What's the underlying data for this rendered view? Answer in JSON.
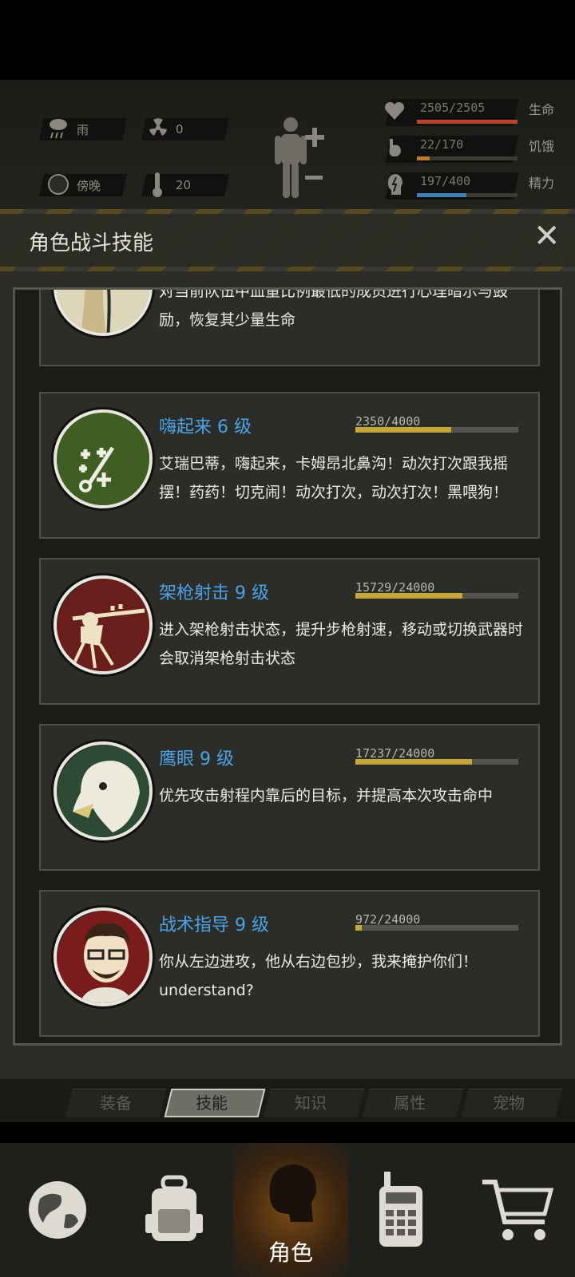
{
  "status": {
    "weather": "雨",
    "radiation": "0",
    "time_of_day": "傍晚",
    "temperature": "20"
  },
  "vitals": [
    {
      "label": "生命",
      "value": "2505/2505",
      "fraction": 1.0,
      "color": "#b8432f"
    },
    {
      "label": "饥饿",
      "value": "22/170",
      "fraction": 0.13,
      "color": "#b87d2f"
    },
    {
      "label": "精力",
      "value": "197/400",
      "fraction": 0.49,
      "color": "#3f7fb8"
    }
  ],
  "panel": {
    "title": "角色战斗技能",
    "close": "✕"
  },
  "skills": [
    {
      "name": "",
      "xp": "",
      "desc": "对当前队伍中血量比例最低的成员进行心理暗示与鼓励，恢复其少量生命",
      "icon": "heal-skill-icon"
    },
    {
      "name": "嗨起来 6 级",
      "xp": "2350/4000",
      "fraction": 0.5875,
      "desc": "艾瑞巴蒂，嗨起来，卡姆昂北鼻沟！动次打次跟我摇摆！药药！切克闹！动次打次，动次打次！黑喂狗！",
      "icon": "party-skill-icon"
    },
    {
      "name": "架枪射击 9 级",
      "xp": "15729/24000",
      "fraction": 0.655,
      "desc": "进入架枪射击状态，提升步枪射速，移动或切换武器时会取消架枪射击状态",
      "icon": "sniper-skill-icon"
    },
    {
      "name": "鹰眼 9 级",
      "xp": "17237/24000",
      "fraction": 0.718,
      "desc": "优先攻击射程内靠后的目标，并提高本次攻击命中",
      "icon": "eagle-skill-icon"
    },
    {
      "name": "战术指导 9 级",
      "xp": "972/24000",
      "fraction": 0.04,
      "desc": "你从左边进攻，他从右边包抄，我来掩护你们！understand?",
      "icon": "tactics-skill-icon"
    }
  ],
  "tabs": [
    "装备",
    "技能",
    "知识",
    "属性",
    "宠物"
  ],
  "nav": {
    "active_label": "角色"
  }
}
